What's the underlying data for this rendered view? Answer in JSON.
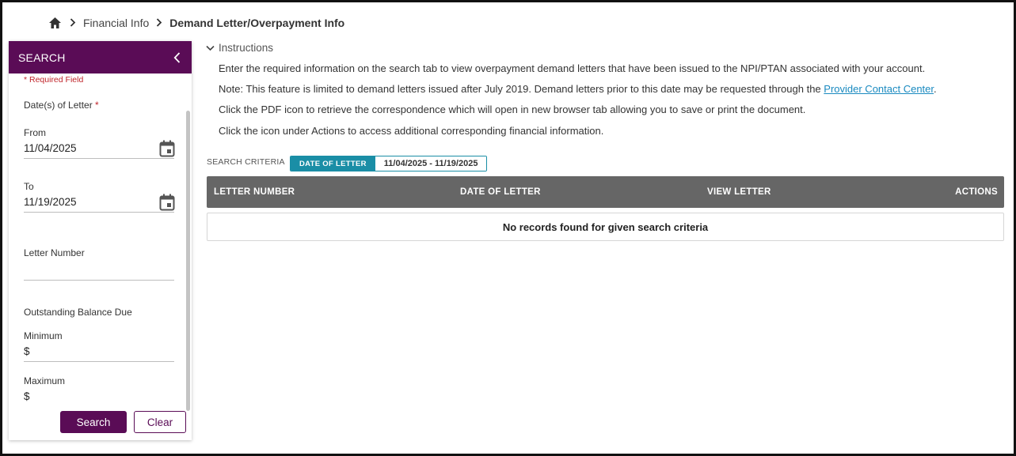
{
  "breadcrumb": {
    "home_icon": "home-icon",
    "items": [
      "Financial Info",
      "Demand Letter/Overpayment Info"
    ]
  },
  "sidebar": {
    "title": "SEARCH",
    "collapse_icon": "chevron-left-icon",
    "required_note": "* Required Field",
    "date_label": "Date(s) of Letter",
    "date_required_mark": "*",
    "from_label": "From",
    "from_value": "11/04/2025",
    "to_label": "To",
    "to_value": "11/19/2025",
    "calendar_icon": "calendar-icon",
    "letter_number_label": "Letter Number",
    "letter_number_value": "",
    "balance_label": "Outstanding Balance Due",
    "minimum_label": "Minimum",
    "minimum_prefix": "$",
    "maximum_label": "Maximum",
    "maximum_prefix": "$",
    "search_button": "Search",
    "clear_button": "Clear"
  },
  "instructions": {
    "toggle_label": "Instructions",
    "toggle_icon": "chevron-down-icon",
    "line1": "Enter the required information on the search tab to view overpayment demand letters that have been issued to the NPI/PTAN associated with your account.",
    "line2_pre": "Note: This feature is limited to demand letters issued after July 2019. Demand letters prior to this date may be requested through the ",
    "line2_link": "Provider Contact Center",
    "line2_post": ".",
    "line3": "Click the PDF icon to retrieve the correspondence which will open in new browser tab allowing you to save or print the document.",
    "line4": "Click the icon under Actions to access additional corresponding financial information."
  },
  "criteria": {
    "label": "SEARCH CRITERIA",
    "chip_key": "DATE OF LETTER",
    "chip_value": "11/04/2025 - 11/19/2025"
  },
  "grid": {
    "columns": [
      "LETTER NUMBER",
      "DATE OF LETTER",
      "VIEW LETTER",
      "ACTIONS"
    ],
    "empty_message": "No records found for given search criteria"
  },
  "colors": {
    "brand_purple": "#5a0c56",
    "accent_teal": "#1a8ea6",
    "link_blue": "#1a8ac0",
    "required_red": "#c0242a",
    "grid_header": "#666666"
  }
}
